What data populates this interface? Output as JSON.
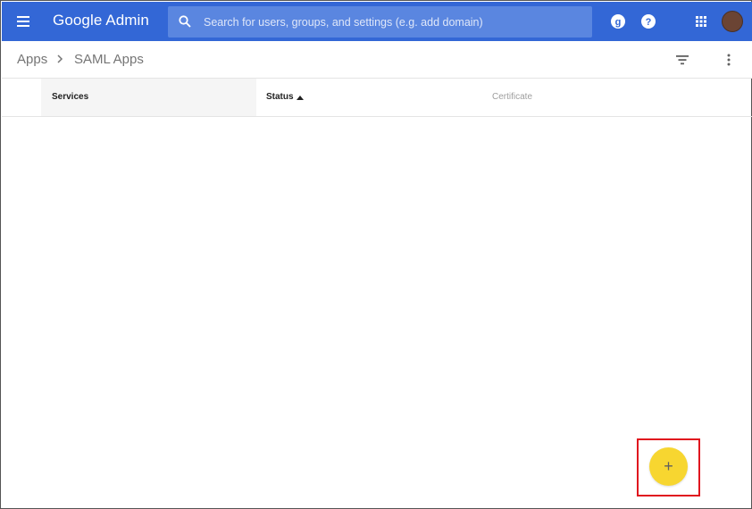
{
  "header": {
    "menu_icon": "menu-icon",
    "brand": "Google Admin",
    "search": {
      "icon": "search-icon",
      "placeholder": "Search for users, groups, and settings (e.g. add domain)"
    },
    "icons": [
      "google-g-icon",
      "help-icon",
      "apps-grid-icon",
      "avatar"
    ],
    "colors": {
      "bar": "#3367d6",
      "search_bg": "#5a86e0",
      "avatar": "#6b4434"
    }
  },
  "breadcrumb": {
    "items": [
      "Apps",
      "SAML Apps"
    ],
    "separator_icon": "chevron-right-icon"
  },
  "toolbar": {
    "icons": [
      "filter-icon",
      "more-vert-icon"
    ]
  },
  "table": {
    "columns": [
      "Services",
      "Status",
      "Certificate"
    ],
    "sorted_column": "Status",
    "sort_direction": "ascending",
    "rows": []
  },
  "fab": {
    "label": "+",
    "icon": "add-icon",
    "color": "#f7d630",
    "highlight_color": "#e0141e"
  }
}
